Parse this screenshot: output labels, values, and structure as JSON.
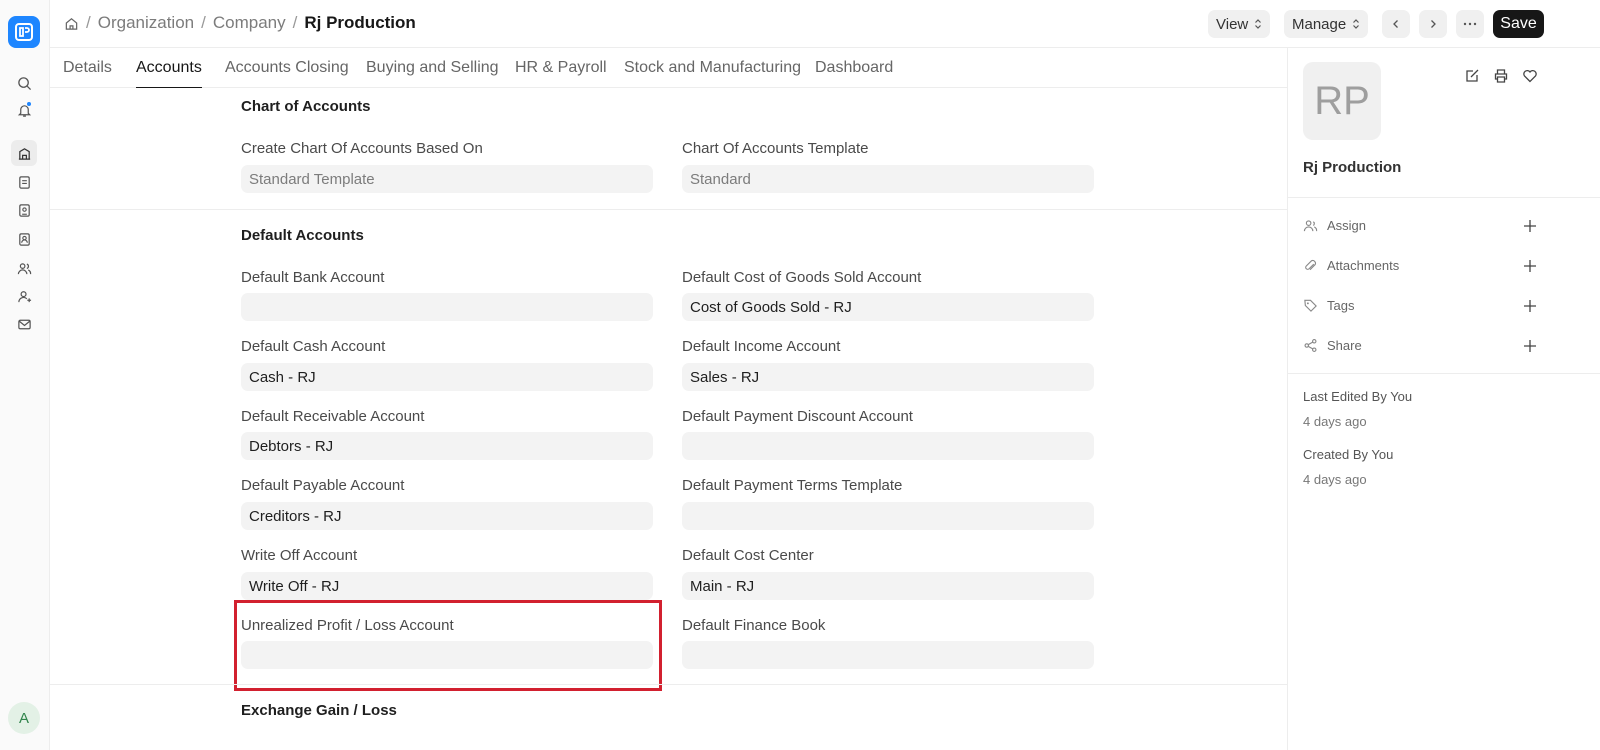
{
  "breadcrumbs": [
    "Organization",
    "Company",
    "Rj Production"
  ],
  "header": {
    "view_label": "View",
    "manage_label": "Manage",
    "save_label": "Save"
  },
  "tabs": [
    "Details",
    "Accounts",
    "Accounts Closing",
    "Buying and Selling",
    "HR & Payroll",
    "Stock and Manufacturing",
    "Dashboard"
  ],
  "active_tab": "Accounts",
  "sections": {
    "chart_of_accounts": {
      "title": "Chart of Accounts",
      "fields": [
        {
          "label": "Create Chart Of Accounts Based On",
          "value": "Standard Template"
        },
        {
          "label": "Chart Of Accounts Template",
          "value": "Standard"
        }
      ]
    },
    "default_accounts": {
      "title": "Default Accounts",
      "fields": [
        {
          "label": "Default Bank Account",
          "value": ""
        },
        {
          "label": "Default Cost of Goods Sold Account",
          "value": "Cost of Goods Sold - RJ"
        },
        {
          "label": "Default Cash Account",
          "value": "Cash - RJ"
        },
        {
          "label": "Default Income Account",
          "value": "Sales - RJ"
        },
        {
          "label": "Default Receivable Account",
          "value": "Debtors - RJ"
        },
        {
          "label": "Default Payment Discount Account",
          "value": ""
        },
        {
          "label": "Default Payable Account",
          "value": "Creditors - RJ"
        },
        {
          "label": "Default Payment Terms Template",
          "value": ""
        },
        {
          "label": "Write Off Account",
          "value": "Write Off - RJ"
        },
        {
          "label": "Default Cost Center",
          "value": "Main - RJ"
        },
        {
          "label": "Unrealized Profit / Loss Account",
          "value": ""
        },
        {
          "label": "Default Finance Book",
          "value": ""
        }
      ]
    },
    "exchange": {
      "title": "Exchange Gain / Loss"
    }
  },
  "sidebar": {
    "avatar_initials": "RP",
    "doc_name": "Rj Production",
    "actions": [
      "Assign",
      "Attachments",
      "Tags",
      "Share"
    ],
    "last_edited": "Last Edited By You",
    "last_edited_time": "4 days ago",
    "created": "Created By You",
    "created_time": "4 days ago"
  },
  "user_avatar": "A",
  "colors": {
    "accent": "#1e86ff",
    "highlight": "#d2202f",
    "primary_button": "#171717"
  }
}
